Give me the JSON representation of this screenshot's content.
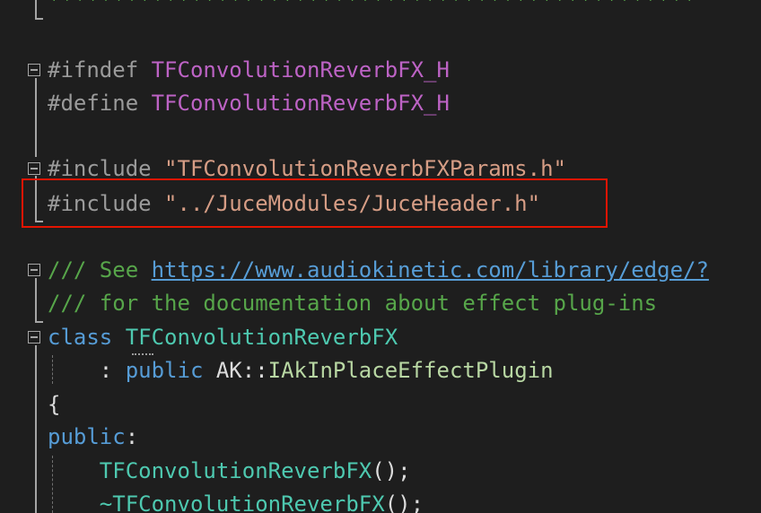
{
  "comment_banner": "**************************************************",
  "lines": {
    "ifndef": {
      "directive": "#ifndef",
      "macro": "TFConvolutionReverbFX_H"
    },
    "define": {
      "directive": "#define",
      "macro": "TFConvolutionReverbFX_H"
    },
    "include1": {
      "directive": "#include",
      "path": "\"TFConvolutionReverbFXParams.h\""
    },
    "include2": {
      "directive": "#include",
      "path": "\"../JuceModules/JuceHeader.h\""
    },
    "comment1": {
      "prefix": "/// See ",
      "link": "https://www.audiokinetic.com/library/edge/?"
    },
    "comment2": {
      "text": "/// for the documentation about effect plug-ins"
    },
    "class_decl": {
      "keyword": "class",
      "name": "TFConvolutionReverbFX"
    },
    "inherit": {
      "colon": ": ",
      "keyword": "public",
      "ns": "AK::",
      "base": "IAkInPlaceEffectPlugin"
    },
    "brace_open": "{",
    "access": {
      "keyword": "public",
      "colon": ":"
    },
    "ctor": {
      "name": "TFConvolutionReverbFX",
      "suffix": "();"
    },
    "dtor": {
      "name": "~TFConvolutionReverbFX",
      "suffix": "();"
    }
  },
  "colors": {
    "background": "#1e1e1e",
    "highlight_box": "#e51400",
    "macro": "#bd63c5",
    "string": "#d69d85",
    "comment": "#57a64a",
    "keyword": "#569cd6",
    "type": "#4ec9b0"
  }
}
